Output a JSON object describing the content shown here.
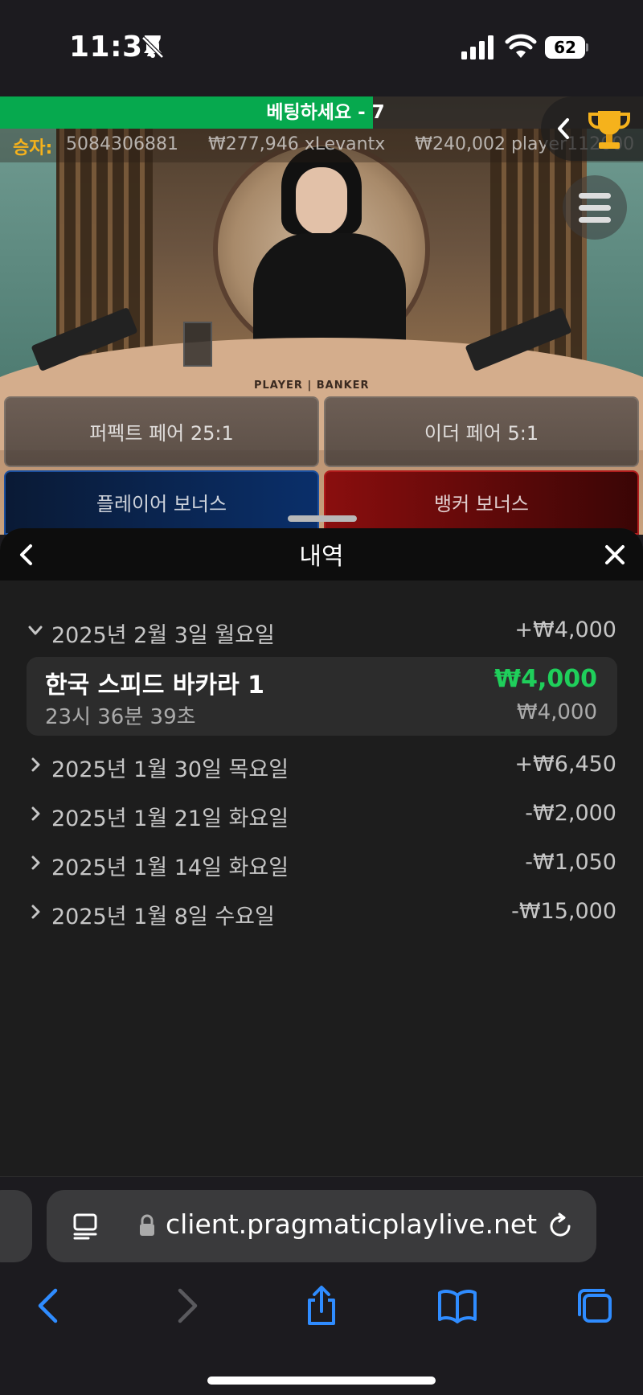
{
  "status_bar": {
    "time": "11:37",
    "battery": "62",
    "icons": [
      "bell-slash-icon",
      "cellular-signal-icon",
      "wifi-icon",
      "battery-icon"
    ]
  },
  "game": {
    "banner": "베팅하세요 - 7",
    "timer_fraction": 0.58,
    "ticker_label": "승자:",
    "ticker_items": [
      "5084306881",
      "₩277,946 xLevantx",
      "₩240,002 player112000"
    ],
    "table_label": "PLAYER | BANKER",
    "bets": {
      "perfect_pair": "퍼펙트 페어 25:1",
      "either_pair": "이더 페어 5:1",
      "player_bonus": "플레이어 보너스",
      "banker_bonus": "뱅커 보너스"
    },
    "colors": {
      "timer": "#06a94e",
      "ticker_label": "#f5b21c",
      "player": "#0a2f6a",
      "banker": "#8a0e0e"
    }
  },
  "history": {
    "title": "내역",
    "days": [
      {
        "label": "2025년 2월 3일 월요일",
        "amount": "+₩4,000",
        "expanded": true
      },
      {
        "label": "2025년 1월 30일 목요일",
        "amount": "+₩6,450",
        "expanded": false
      },
      {
        "label": "2025년 1월 21일 화요일",
        "amount": "-₩2,000",
        "expanded": false
      },
      {
        "label": "2025년 1월 14일 화요일",
        "amount": "-₩1,050",
        "expanded": false
      },
      {
        "label": "2025년 1월 8일 수요일",
        "amount": "-₩15,000",
        "expanded": false
      }
    ],
    "round": {
      "game": "한국 스피드 바카라 1",
      "time": "23시 36분 39초",
      "win": "₩4,000",
      "bet": "₩4,000"
    },
    "colors": {
      "win": "#1fcf5b"
    }
  },
  "browser": {
    "url": "client.pragmaticplaylive.net",
    "nav_icons": [
      "back-icon",
      "forward-icon",
      "share-icon",
      "bookmarks-icon",
      "tabs-icon"
    ]
  }
}
